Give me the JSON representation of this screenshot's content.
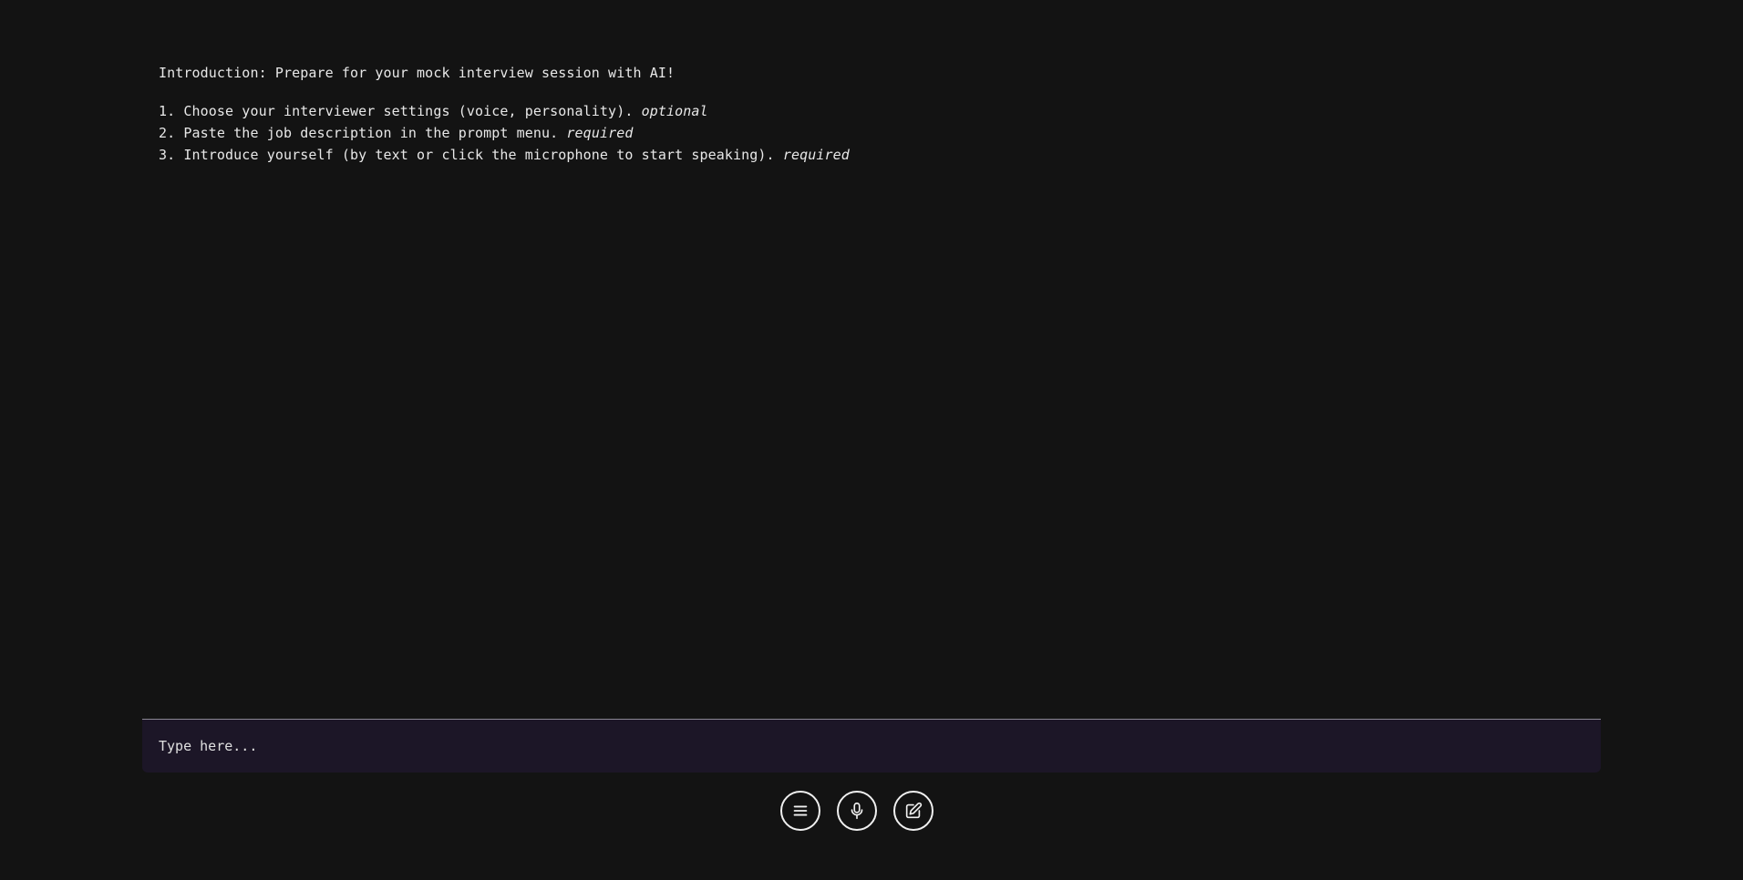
{
  "intro": {
    "title": "Introduction: Prepare for your mock interview session with AI!",
    "steps": [
      {
        "text": "1. Choose your interviewer settings (voice, personality). ",
        "tag": "optional"
      },
      {
        "text": "2. Paste the job description in the prompt menu. ",
        "tag": "required"
      },
      {
        "text": "3. Introduce yourself (by text or click the microphone to start speaking). ",
        "tag": "required"
      }
    ]
  },
  "input": {
    "placeholder": "Type here...",
    "value": ""
  },
  "controls": {
    "menu_icon": "menu-icon",
    "mic_icon": "microphone-icon",
    "edit_icon": "edit-icon"
  },
  "colors": {
    "background": "#131313",
    "input_background": "#1c1627",
    "text": "#e8e8e8",
    "button_border": "#f0f0f0"
  }
}
